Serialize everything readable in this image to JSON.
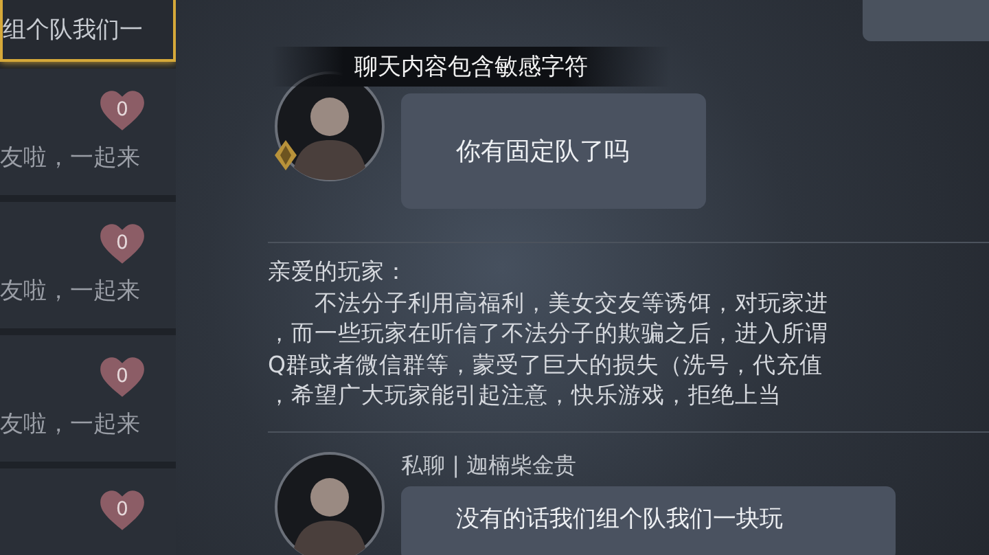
{
  "conversations": [
    {
      "preview": "组个队我们一",
      "selected": true
    },
    {
      "likes": "0",
      "preview": "友啦，一起来",
      "selected": false
    },
    {
      "likes": "0",
      "preview": "友啦，一起来",
      "selected": false
    },
    {
      "likes": "0",
      "preview": "友啦，一起来",
      "selected": false
    },
    {
      "likes": "0",
      "selected": false
    }
  ],
  "toast": "聊天内容包含敏感字符",
  "messages": [
    {
      "kind": "chat",
      "badge": true,
      "text": "你有固定队了吗"
    },
    {
      "kind": "notice",
      "lines": [
        "亲爱的玩家：",
        "不法分子利用高福利，美女交友等诱饵，对玩家进",
        "，而一些玩家在听信了不法分子的欺骗之后，进入所谓",
        "Q群或者微信群等，蒙受了巨大的损失（洗号，代充值",
        "，希望广大玩家能引起注意，快乐游戏，拒绝上当"
      ]
    },
    {
      "kind": "chat",
      "badge": false,
      "sender": "私聊 | 迦楠柴金贵",
      "text": "没有的话我们组个队我们一块玩"
    }
  ]
}
